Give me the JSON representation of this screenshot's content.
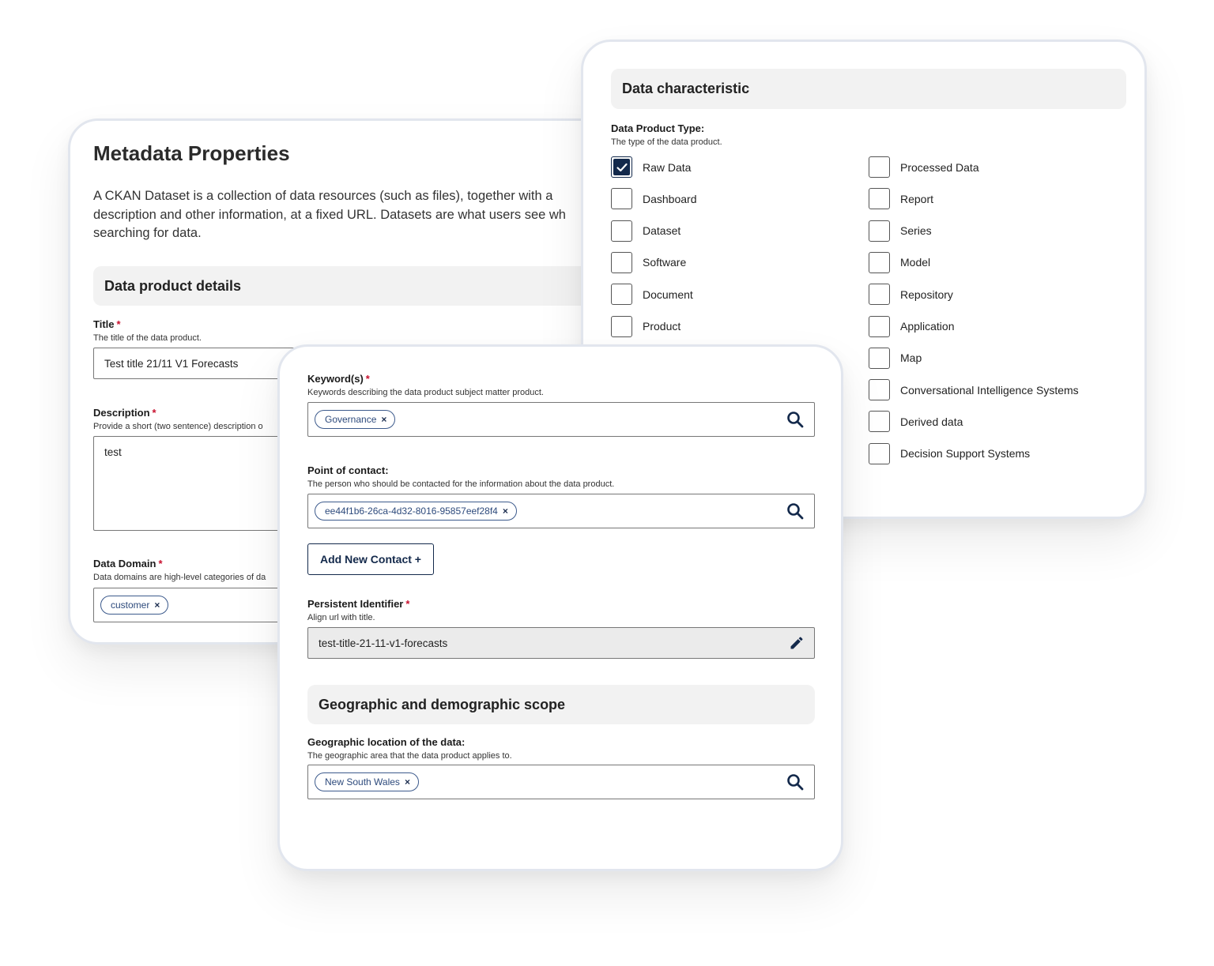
{
  "metadata_card": {
    "title": "Metadata Properties",
    "intro_line1": "A CKAN Dataset is a collection of data resources (such as files), together with a",
    "intro_line2": "description and other information, at a fixed URL. Datasets are what users see wh",
    "intro_line3": "searching for data.",
    "section_title": "Data product details",
    "title_field": {
      "label": "Title",
      "required": "*",
      "hint": "The title of the data product.",
      "value": "Test title 21/11 V1  Forecasts"
    },
    "description_field": {
      "label": "Description",
      "required": "*",
      "hint": "Provide a short (two sentence) description o",
      "value": "test"
    },
    "domain_field": {
      "label": "Data Domain",
      "required": "*",
      "hint": "Data domains are high-level categories of da",
      "chip": "customer",
      "chip_remove": "×"
    }
  },
  "characteristic_card": {
    "section_title": "Data characteristic",
    "type_label": "Data Product Type:",
    "type_hint": "The type of the data product.",
    "left_options": [
      {
        "label": "Raw Data",
        "checked": true
      },
      {
        "label": "Dashboard",
        "checked": false
      },
      {
        "label": "Dataset",
        "checked": false
      },
      {
        "label": "Software",
        "checked": false
      },
      {
        "label": "Document",
        "checked": false
      },
      {
        "label": "Product",
        "checked": false
      }
    ],
    "right_options": [
      {
        "label": "Processed Data",
        "checked": false
      },
      {
        "label": "Report",
        "checked": false
      },
      {
        "label": "Series",
        "checked": false
      },
      {
        "label": "Model",
        "checked": false
      },
      {
        "label": "Repository",
        "checked": false
      },
      {
        "label": "Application",
        "checked": false
      },
      {
        "label": "Map",
        "checked": false
      },
      {
        "label": "Conversational Intelligence Systems",
        "checked": false
      },
      {
        "label": "Derived data",
        "checked": false
      },
      {
        "label": "Decision Support Systems",
        "checked": false
      }
    ]
  },
  "front_card": {
    "keywords": {
      "label": "Keyword(s)",
      "required": "*",
      "hint": "Keywords describing the data product subject matter product.",
      "chip": "Governance",
      "chip_remove": "×"
    },
    "contact": {
      "label": "Point of contact:",
      "hint": "The person who should be contacted for the information about the data product.",
      "chip": "ee44f1b6-26ca-4d32-8016-95857eef28f4",
      "chip_remove": "×"
    },
    "add_contact_button": "Add New Contact +",
    "identifier": {
      "label": "Persistent Identifier",
      "required": "*",
      "hint": "Align url with title.",
      "value": "test-title-21-11-v1-forecasts"
    },
    "geo_section_title": "Geographic and demographic scope",
    "geo_location": {
      "label": "Geographic location of the data:",
      "hint": "The geographic area that the data product applies to.",
      "chip": "New South Wales",
      "chip_remove": "×"
    }
  },
  "colors": {
    "navy": "#13294b",
    "chip_border": "#3c5a8c",
    "required": "#c8102e",
    "section_bg": "#f2f2f2",
    "card_border": "#e2e6ee"
  }
}
